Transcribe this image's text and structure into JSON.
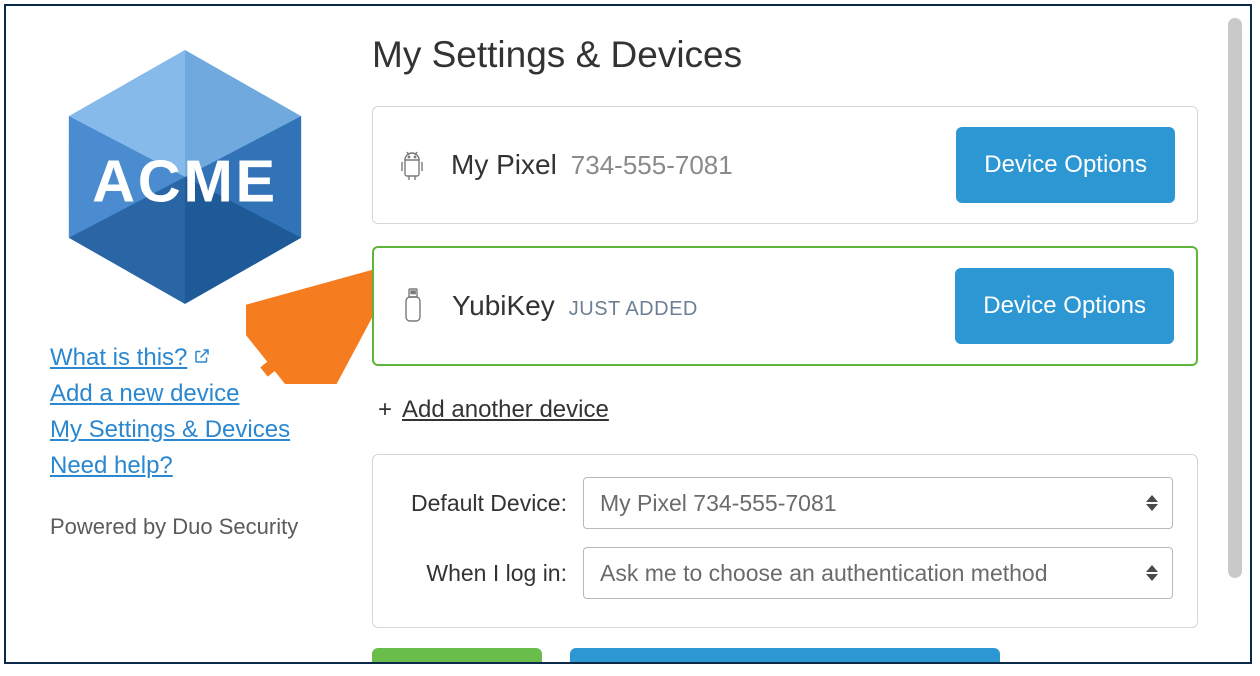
{
  "brand": {
    "name": "ACME"
  },
  "sidebar": {
    "links": {
      "what_is_this": "What is this?",
      "add_device": "Add a new device",
      "my_settings": "My Settings & Devices",
      "need_help": "Need help?"
    },
    "powered_by": "Powered by Duo Security"
  },
  "main": {
    "title": "My Settings & Devices",
    "devices": [
      {
        "name": "My Pixel",
        "sub": "734-555-7081",
        "badge": "",
        "icon": "android",
        "options_label": "Device Options"
      },
      {
        "name": "YubiKey",
        "sub": "",
        "badge": "JUST ADDED",
        "icon": "usb",
        "options_label": "Device Options"
      }
    ],
    "add_another": "Add another device",
    "settings": {
      "default_device_label": "Default Device:",
      "default_device_value": "My Pixel 734-555-7081",
      "login_label": "When I log in:",
      "login_value": "Ask me to choose an authentication method"
    }
  },
  "colors": {
    "accent_blue": "#2d97d3",
    "accent_green": "#5eb53a",
    "link_blue": "#2a87d0"
  }
}
